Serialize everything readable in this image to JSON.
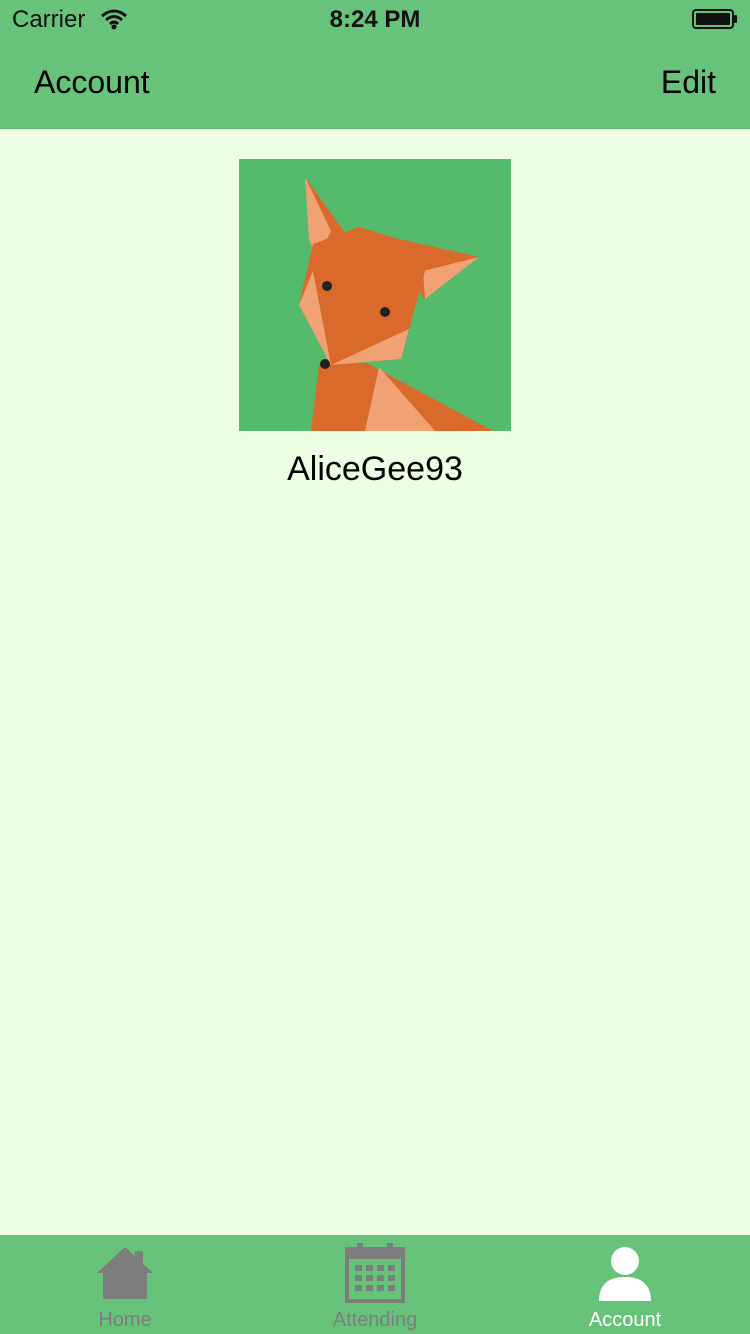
{
  "status_bar": {
    "carrier": "Carrier",
    "time": "8:24 PM"
  },
  "nav": {
    "title": "Account",
    "edit_label": "Edit"
  },
  "profile": {
    "username": "AliceGee93"
  },
  "tabs": [
    {
      "label": "Home",
      "icon": "home-icon",
      "active": false
    },
    {
      "label": "Attending",
      "icon": "calendar-icon",
      "active": false
    },
    {
      "label": "Account",
      "icon": "person-icon",
      "active": true
    }
  ],
  "colors": {
    "bar_green": "#68C37A",
    "background": "#EEFEE2",
    "inactive_tab": "#7D7D7D",
    "active_tab": "#FFFFFF"
  }
}
